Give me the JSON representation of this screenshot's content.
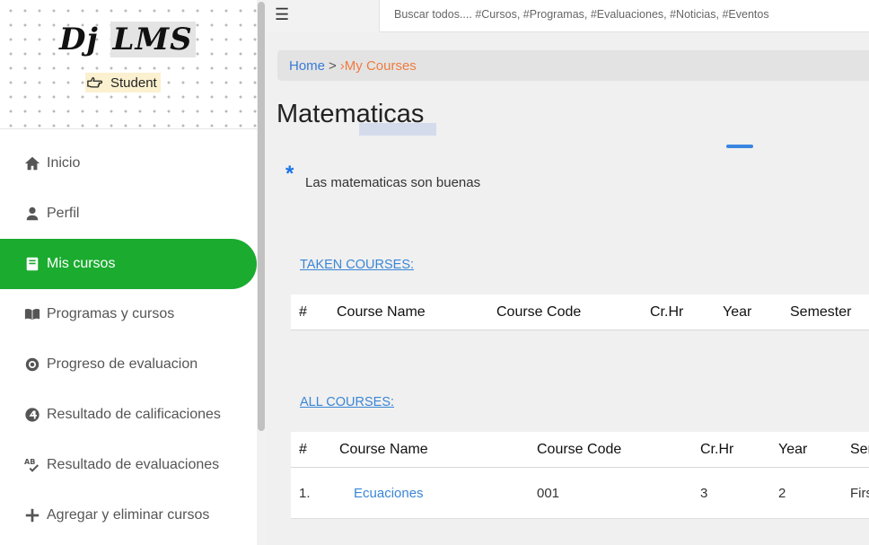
{
  "brand": {
    "logo_prefix": "Dj",
    "logo_highlight": "LMS",
    "role": "Student"
  },
  "sidebar": {
    "items": [
      {
        "label": "Inicio",
        "icon": "home-icon"
      },
      {
        "label": "Perfil",
        "icon": "user-icon"
      },
      {
        "label": "Mis cursos",
        "icon": "book-icon",
        "active": true
      },
      {
        "label": "Programas y cursos",
        "icon": "open-book-icon"
      },
      {
        "label": "Progreso de evaluacion",
        "icon": "target-icon"
      },
      {
        "label": "Resultado de calificaciones",
        "icon": "grade-circle-icon"
      },
      {
        "label": "Resultado de evaluaciones",
        "icon": "spellcheck-icon"
      },
      {
        "label": "Agregar y eliminar cursos",
        "icon": "plus-icon"
      }
    ]
  },
  "topbar": {
    "menu_icon": "hamburger-icon",
    "search_placeholder": "Buscar todos.... #Cursos, #Programas, #Evaluaciones, #Noticias, #Eventos"
  },
  "breadcrumb": {
    "home": "Home",
    "separator": ">",
    "current": "›My Courses"
  },
  "course": {
    "title": "Matematicas",
    "asterisk": "*",
    "description": "Las matematicas son buenas"
  },
  "taken": {
    "link": "TAKEN COURSES:",
    "headers": [
      "#",
      "Course Name",
      "Course Code",
      "Cr.Hr",
      "Year",
      "Semester"
    ]
  },
  "all": {
    "link": "ALL COURSES:",
    "headers": [
      "#",
      "Course Name",
      "Course Code",
      "Cr.Hr",
      "Year",
      "Ser"
    ],
    "rows": [
      {
        "num": "1.",
        "name": "Ecuaciones",
        "code": "001",
        "crhr": "3",
        "year": "2",
        "semester": "Firs"
      }
    ]
  },
  "colors": {
    "active_nav": "#1aab2f",
    "link": "#3a86d5",
    "crumb_current": "#f07b3f"
  }
}
